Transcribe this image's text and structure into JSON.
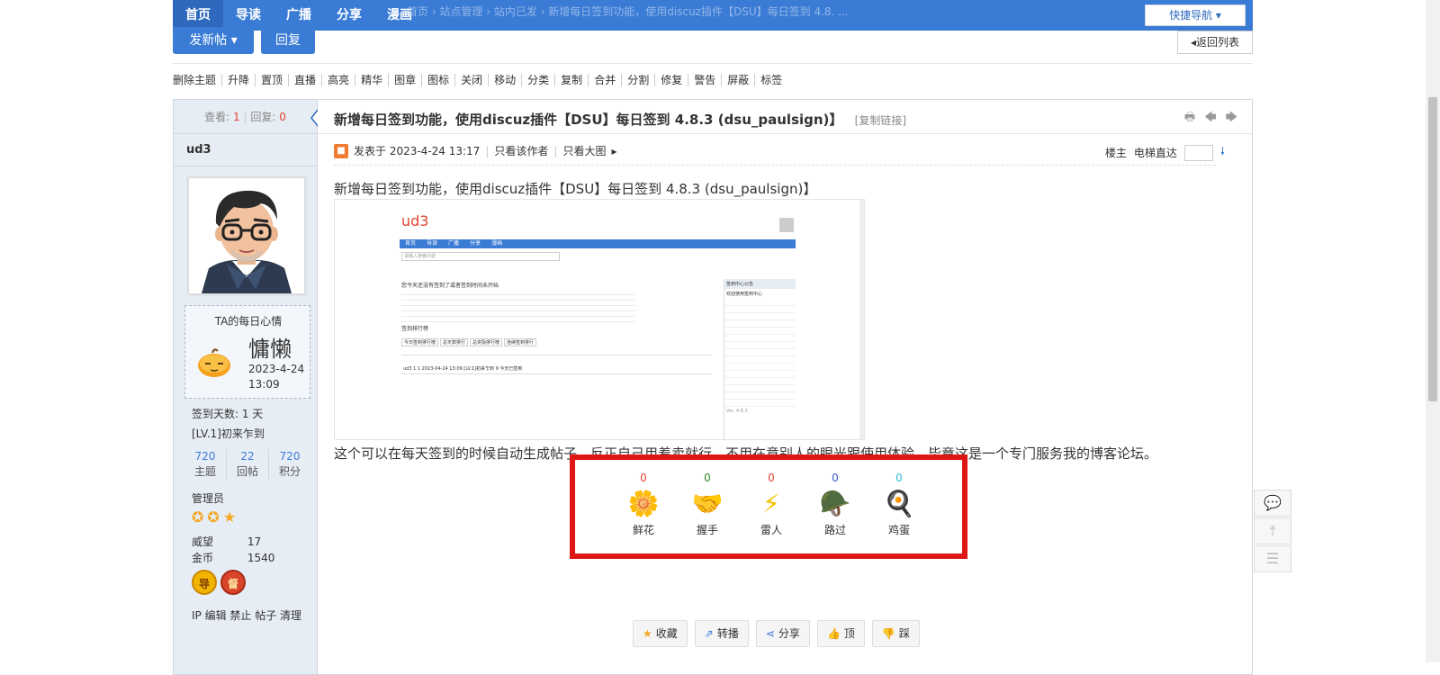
{
  "topnav": {
    "items": [
      "首页",
      "导读",
      "广播",
      "分享",
      "漫画"
    ],
    "breadcrumb_ghost": "首页 › 站点管理 › 站内已发 › 新增每日签到功能，使用discuz插件【DSU】每日签到 4.8. ...",
    "quicknav": "快捷导航 ▾"
  },
  "buttons": {
    "post": "发新帖 ▾",
    "reply": "回复",
    "back": "◂返回列表"
  },
  "modbar": [
    "删除主题",
    "升降",
    "置顶",
    "直播",
    "高亮",
    "精华",
    "图章",
    "图标",
    "关闭",
    "移动",
    "分类",
    "复制",
    "合并",
    "分割",
    "修复",
    "警告",
    "屏蔽",
    "标签"
  ],
  "sidebar": {
    "views_label": "查看:",
    "views": "1",
    "replies_label": "回复:",
    "replies": "0",
    "username": "ud3",
    "mood_title": "TA的每日心情",
    "mood_word": "慵懒",
    "mood_date": "2023-4-24",
    "mood_time": "13:09",
    "signin_days": "签到天数: 1 天",
    "level": "[LV.1]初来乍到",
    "counts": [
      {
        "value": "720",
        "label": "主题"
      },
      {
        "value": "22",
        "label": "回帖"
      },
      {
        "value": "720",
        "label": "积分"
      }
    ],
    "role": "管理员",
    "stars": "✪✪★",
    "prestige_label": "威望",
    "prestige": "17",
    "gold_label": "金币",
    "gold": "1540",
    "medal1": "导",
    "medal2": "督",
    "actions": "IP 编辑 禁止 帖子 清理"
  },
  "post": {
    "title": "新增每日签到功能，使用discuz插件【DSU】每日签到 4.8.3 (dsu_paulsign)】",
    "copy_link": "[复制链接]",
    "posted_at": "发表于 2023-4-24 13:17",
    "author_only": "只看该作者",
    "big_image": "只看大图",
    "floor_owner": "楼主",
    "elevator": "电梯直达",
    "heading": "新增每日签到功能，使用discuz插件【DSU】每日签到 4.8.3 (dsu_paulsign)】",
    "body": "这个可以在每天签到的时候自动生成帖子，反正自己用着卖就行，不用在意别人的眼光跟使用体验，毕竟这是一个专门服务我的博客论坛。"
  },
  "screenshot": {
    "logo": "ud3",
    "nav": [
      "首页",
      "导读",
      "广播",
      "分享",
      "漫画"
    ],
    "search_placeholder": "请输入搜索内容",
    "heading": "您今天还没有签到了或者签到时间未开始",
    "section": "签到排行榜",
    "tabs": [
      "今日签到排行榜",
      "总天数排行",
      "总奖励排行榜",
      "连续签到排行"
    ],
    "table_row": "ud3   1   1   2023-04-24 13:09   [LV.1]初来乍到   9   今天已签到",
    "side_title": "签到中心公告",
    "side_text": "欢迎使用签到中心",
    "version": "Ver. 4.8.3"
  },
  "reactions": [
    {
      "count": "0",
      "label": "鲜花",
      "icon": "flower-icon",
      "color": "#e0432f",
      "glyph": "🌼"
    },
    {
      "count": "0",
      "label": "握手",
      "icon": "handshake-icon",
      "color": "#2a8a2a",
      "glyph": "🤝"
    },
    {
      "count": "0",
      "label": "雷人",
      "icon": "lightning-icon",
      "color": "#e0432f",
      "glyph": "⚡"
    },
    {
      "count": "0",
      "label": "路过",
      "icon": "soldier-icon",
      "color": "#3a5cc9",
      "glyph": "🪖"
    },
    {
      "count": "0",
      "label": "鸡蛋",
      "icon": "egg-icon",
      "color": "#35b8d8",
      "glyph": "🍳"
    }
  ],
  "post_actions": [
    {
      "icon": "star-icon",
      "glyph": "★",
      "label": "收藏"
    },
    {
      "icon": "repost-icon",
      "glyph": "⇗",
      "label": "转播"
    },
    {
      "icon": "share-icon",
      "glyph": "⋖",
      "label": "分享"
    },
    {
      "icon": "thumbs-up-icon",
      "glyph": "👍",
      "label": "顶"
    },
    {
      "icon": "thumbs-down-icon",
      "glyph": "👎",
      "label": "踩"
    }
  ]
}
